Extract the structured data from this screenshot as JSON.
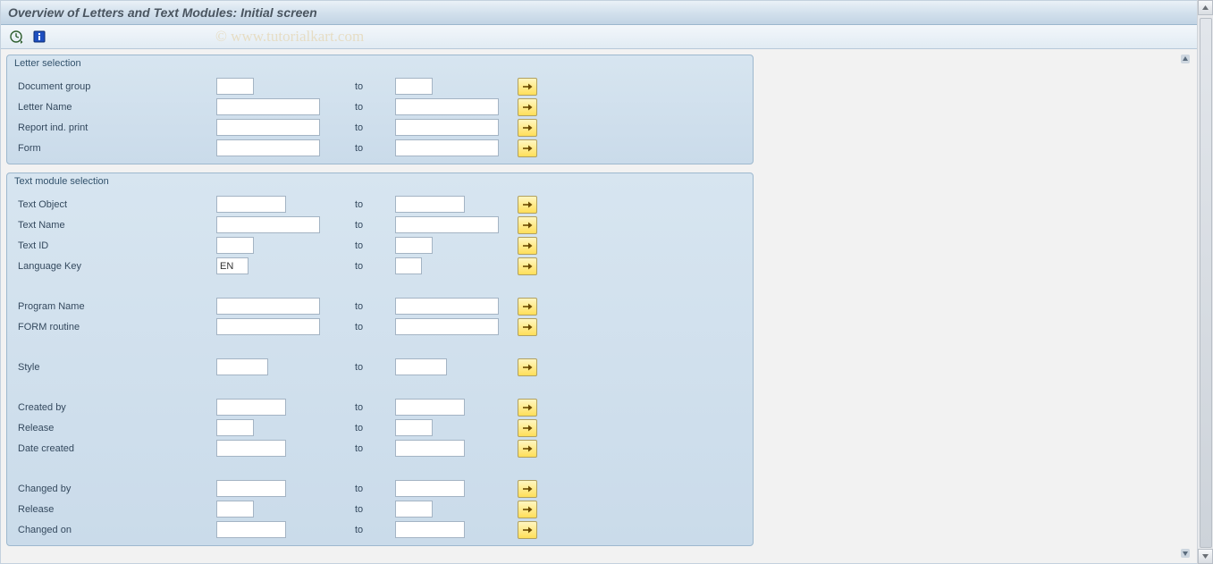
{
  "title": "Overview of Letters and Text Modules: Initial screen",
  "watermark": "© www.tutorialkart.com",
  "toolbar": {
    "exec": "Execute",
    "info": "Information"
  },
  "to_label": "to",
  "groups": {
    "letter": {
      "title": "Letter selection",
      "rows": [
        {
          "label": "Document group",
          "fromSize": "short",
          "toSize": "short",
          "from": "",
          "to": ""
        },
        {
          "label": "Letter Name",
          "fromSize": "std",
          "toSize": "std",
          "from": "",
          "to": ""
        },
        {
          "label": "Report ind. print",
          "fromSize": "std",
          "toSize": "std",
          "from": "",
          "to": ""
        },
        {
          "label": "Form",
          "fromSize": "std",
          "toSize": "std",
          "from": "",
          "to": ""
        }
      ]
    },
    "textmod": {
      "title": "Text module selection",
      "rows": [
        {
          "label": "Text Object",
          "fromSize": "med",
          "toSize": "med",
          "from": "",
          "to": ""
        },
        {
          "label": "Text Name",
          "fromSize": "std",
          "toSize": "std",
          "from": "",
          "to": ""
        },
        {
          "label": "Text ID",
          "fromSize": "short",
          "toSize": "short",
          "from": "",
          "to": ""
        },
        {
          "label": "Language Key",
          "fromSize": "lang",
          "toSize": "tiny",
          "from": "EN",
          "to": ""
        },
        {
          "spacer": true
        },
        {
          "label": "Program Name",
          "fromSize": "std",
          "toSize": "std",
          "from": "",
          "to": ""
        },
        {
          "label": "FORM routine",
          "fromSize": "std",
          "toSize": "std",
          "from": "",
          "to": ""
        },
        {
          "spacer": true
        },
        {
          "label": "Style",
          "fromSize": "smallish",
          "toSize": "smallish",
          "from": "",
          "to": ""
        },
        {
          "spacer": true
        },
        {
          "label": "Created by",
          "fromSize": "med",
          "toSize": "med",
          "from": "",
          "to": ""
        },
        {
          "label": "Release",
          "fromSize": "short",
          "toSize": "short",
          "from": "",
          "to": ""
        },
        {
          "label": "Date created",
          "fromSize": "med",
          "toSize": "med",
          "from": "",
          "to": ""
        },
        {
          "spacer": true
        },
        {
          "label": "Changed by",
          "fromSize": "med",
          "toSize": "med",
          "from": "",
          "to": ""
        },
        {
          "label": "Release",
          "fromSize": "short",
          "toSize": "short",
          "from": "",
          "to": ""
        },
        {
          "label": "Changed on",
          "fromSize": "med",
          "toSize": "med",
          "from": "",
          "to": ""
        }
      ]
    }
  }
}
